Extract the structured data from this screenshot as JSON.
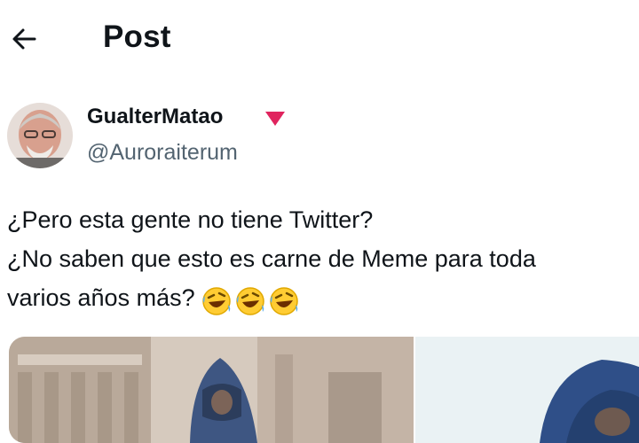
{
  "header": {
    "title": "Post",
    "back_icon": "arrow-left-icon"
  },
  "author": {
    "name": "GualterMatao",
    "handle": "@Auroraiterum",
    "badge_icon": "red-triangle-icon",
    "badge_color": "#e0245e"
  },
  "tweet": {
    "lines": [
      "¿Pero esta gente no tiene Twitter?",
      "¿No saben que esto es carne de Meme para toda",
      "varios años más?"
    ],
    "emojis": [
      "rolling-on-floor-laughing-icon",
      "rolling-on-floor-laughing-icon",
      "rolling-on-floor-laughing-icon"
    ]
  },
  "colors": {
    "text": "#0f1419",
    "secondary": "#536471"
  }
}
